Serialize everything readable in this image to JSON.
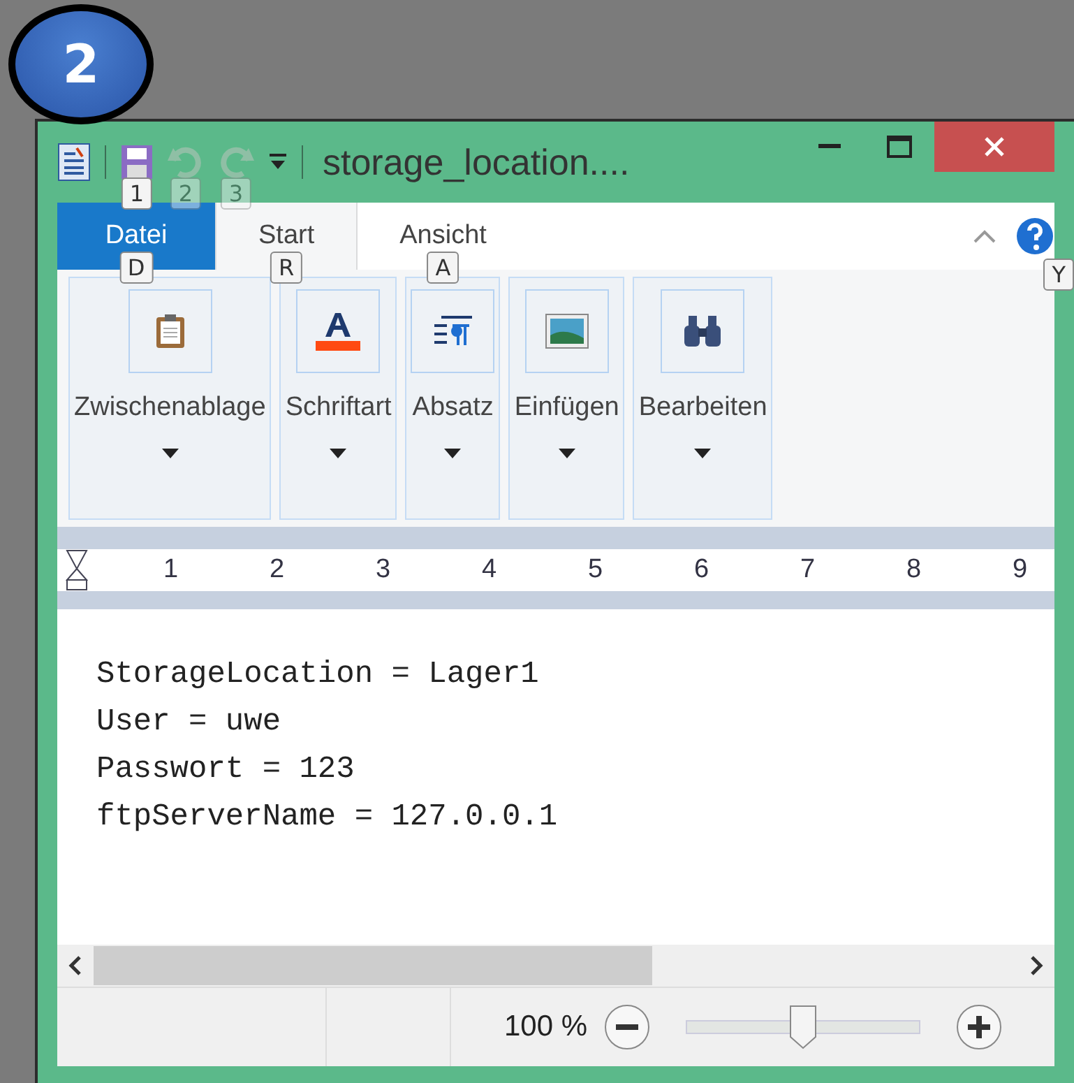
{
  "badge": "2",
  "window": {
    "title": "storage_location...."
  },
  "quick_access": [
    {
      "kind": "save",
      "keytip": "1",
      "disabled": false
    },
    {
      "kind": "undo",
      "keytip": "2",
      "disabled": true
    },
    {
      "kind": "redo",
      "keytip": "3",
      "disabled": true
    }
  ],
  "tabs": [
    {
      "label": "Datei",
      "keytip": "D",
      "kind": "file",
      "selected": false
    },
    {
      "label": "Start",
      "keytip": "R",
      "kind": "tab",
      "selected": true
    },
    {
      "label": "Ansicht",
      "keytip": "A",
      "kind": "tab",
      "selected": false
    }
  ],
  "help_keytip": "Y",
  "ribbon_groups": [
    {
      "label": "Zwischenablage",
      "kind": "clipboard"
    },
    {
      "label": "Schriftart",
      "kind": "font"
    },
    {
      "label": "Absatz",
      "kind": "paragraph"
    },
    {
      "label": "Einfügen",
      "kind": "picture"
    },
    {
      "label": "Bearbeiten",
      "kind": "find"
    }
  ],
  "ruler": [
    "1",
    "2",
    "3",
    "4",
    "5",
    "6",
    "7",
    "8",
    "9"
  ],
  "document": {
    "lines": [
      "StorageLocation = Lager1",
      "User = uwe",
      "Passwort = 123",
      "ftpServerName = 127.0.0.1"
    ]
  },
  "status_bar": {
    "zoom": "100 %",
    "zoom_slider": {
      "level": 0.5
    }
  }
}
